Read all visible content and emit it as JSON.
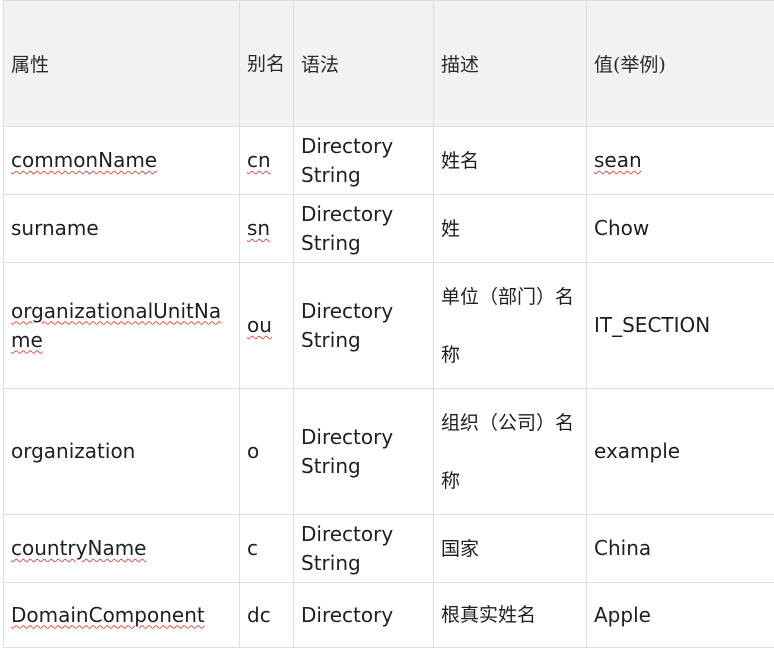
{
  "headers": {
    "attribute": "属性",
    "alias": "别名",
    "syntax": "语法",
    "description": "描述",
    "value": "值(举例)"
  },
  "rows": [
    {
      "attribute": "commonName",
      "alias": "cn",
      "syntax": "Directory String",
      "description": "姓名",
      "value": "sean"
    },
    {
      "attribute": "surname",
      "alias": "sn",
      "syntax": "Directory String",
      "description": "姓",
      "value": "Chow"
    },
    {
      "attribute": "organizationalUnitName",
      "alias": "ou",
      "syntax": "Directory String",
      "description": "单位（部门）名称",
      "value": "IT_SECTION"
    },
    {
      "attribute": "organization",
      "alias": "o",
      "syntax": "Directory String",
      "description": "组织（公司）名称",
      "value": "example"
    },
    {
      "attribute": "countryName",
      "alias": "c",
      "syntax": "Directory String",
      "description": "国家",
      "value": "China"
    },
    {
      "attribute": "DomainComponent",
      "alias": "dc",
      "syntax": "Directory",
      "description": "根真实姓名",
      "value": "Apple"
    }
  ]
}
